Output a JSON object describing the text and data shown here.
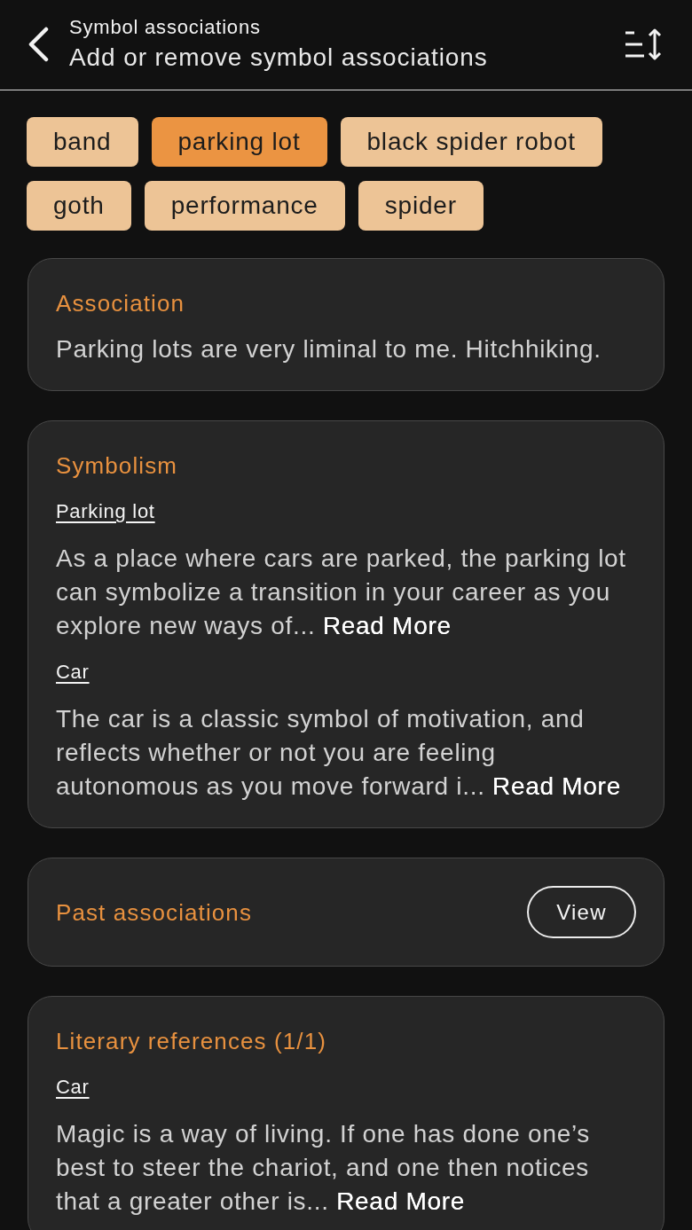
{
  "header": {
    "subtitle": "Symbol associations",
    "title": "Add or remove symbol associations"
  },
  "chips": [
    {
      "label": "band",
      "selected": false
    },
    {
      "label": "parking lot",
      "selected": true
    },
    {
      "label": "black spider robot",
      "selected": false
    },
    {
      "label": "goth",
      "selected": false
    },
    {
      "label": "performance",
      "selected": false
    },
    {
      "label": "spider",
      "selected": false
    }
  ],
  "cards": [
    {
      "kind": "text",
      "title": "Association",
      "text": "Parking lots are very liminal to me. Hitchhiking."
    },
    {
      "kind": "entries",
      "title": "Symbolism",
      "entries": [
        {
          "heading": "Parking lot",
          "text": "As a place where cars are parked, the parking lot can symbolize a transition in your career as you explore new ways of...",
          "link": "Read More"
        },
        {
          "heading": "Car",
          "text": "The car is a classic symbol of motivation, and reflects whether or not you are feeling autonomous as you move forward i...",
          "link": "Read More"
        }
      ]
    },
    {
      "kind": "action",
      "title": "Past associations",
      "button": "View"
    },
    {
      "kind": "entries",
      "title": "Literary references (1/1)",
      "entries": [
        {
          "heading": "Car",
          "text": "Magic is a way of living. If one has done one’s best to steer the chariot, and one then notices that a greater other is...",
          "link": "Read More"
        }
      ]
    }
  ]
}
